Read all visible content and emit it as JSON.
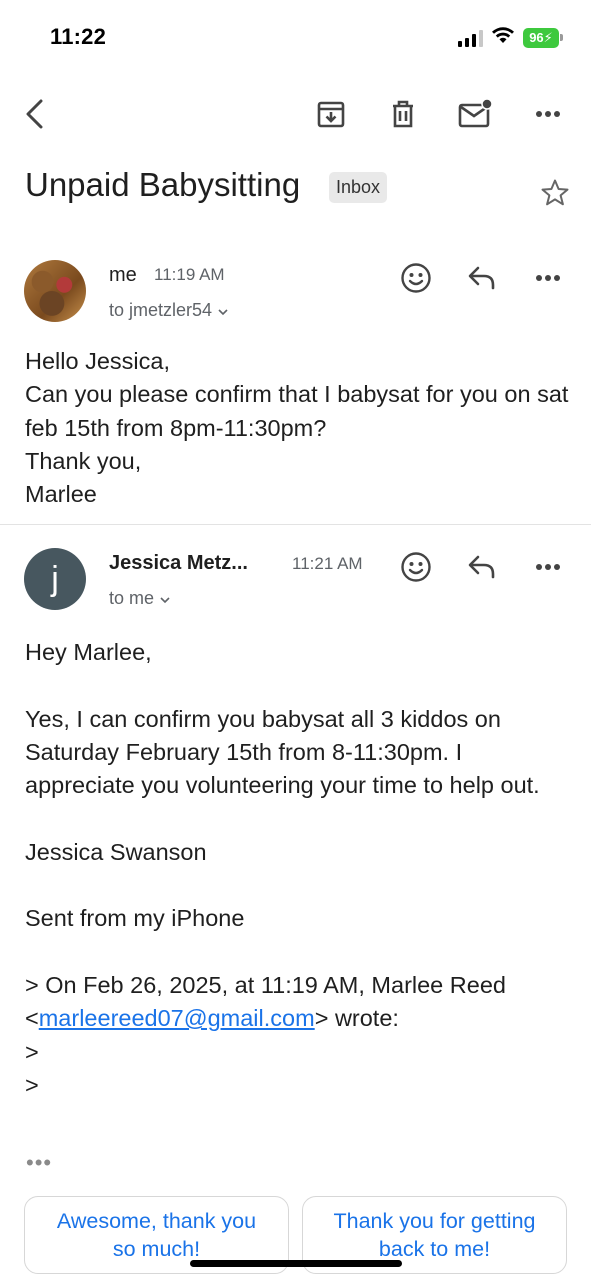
{
  "status_bar": {
    "time": "11:22",
    "battery": "96"
  },
  "toolbar": {
    "icons": [
      "back-arrow-icon",
      "archive-icon",
      "trash-icon",
      "mark-unread-icon",
      "more-icon"
    ]
  },
  "thread": {
    "subject": "Unpaid Babysitting",
    "label": "Inbox"
  },
  "messages": [
    {
      "sender": "me",
      "time": "11:19 AM",
      "to": "to jmetzler54",
      "body": [
        "Hello Jessica,",
        "Can you please confirm that I babysat for you on sat feb 15th from 8pm-11:30pm?",
        "Thank you,",
        "Marlee"
      ]
    },
    {
      "sender": "Jessica Metz...",
      "avatar_letter": "j",
      "time": "11:21 AM",
      "to": "to me",
      "body": {
        "greeting": "Hey Marlee,",
        "paragraph": "Yes, I can confirm you babysat all 3 kiddos on Saturday February 15th from 8-11:30pm. I appreciate you volunteering your time to help out.",
        "signature": "Jessica Swanson",
        "sent_from": "Sent from my iPhone",
        "quote_prefix": "> On Feb 26, 2025, at 11:19 AM, Marlee Reed",
        "quote_link_open": "<",
        "quote_email": "marleereed07@gmail.com",
        "quote_suffix": "> wrote:",
        "quote_line_1": ">",
        "quote_line_2": ">"
      },
      "collapsed_indicator": "•••"
    }
  ],
  "smart_replies": [
    "Awesome, thank you so much!",
    "Thank you for getting back to me!"
  ],
  "colors": {
    "accent_link": "#1a73e8",
    "battery_green": "#3ec93e",
    "avatar_j": "#47575f"
  }
}
